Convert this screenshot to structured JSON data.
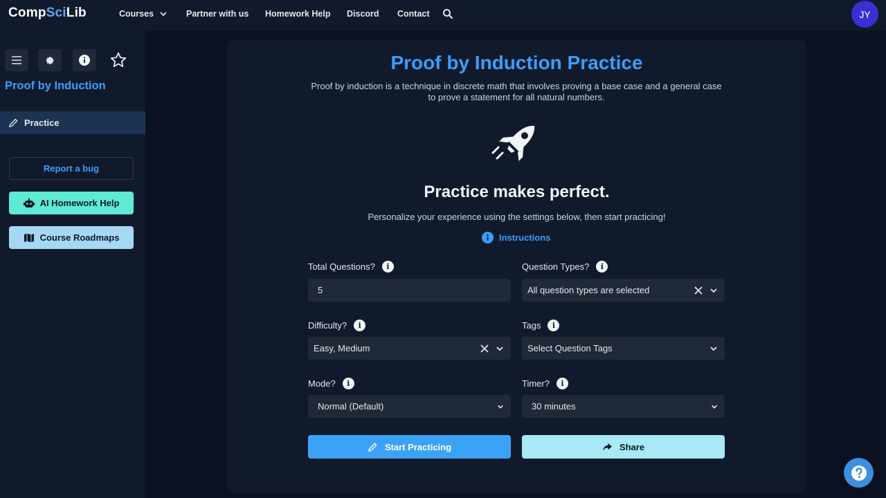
{
  "brand": {
    "name_part1": "Comp",
    "name_part2": "Sci",
    "name_part3": "Lib"
  },
  "nav": {
    "items": [
      {
        "label": "Courses",
        "has_dropdown": true
      },
      {
        "label": "Partner with us"
      },
      {
        "label": "Homework Help"
      },
      {
        "label": "Discord"
      },
      {
        "label": "Contact"
      }
    ],
    "search_icon": "search-icon",
    "avatar_initials": "JY"
  },
  "sidebar": {
    "icons": [
      "menu-icon",
      "gear-icon",
      "info-icon",
      "star-icon"
    ],
    "title": "Proof by Induction",
    "practice_label": "Practice",
    "report_label": "Report a bug",
    "ai_label": "AI Homework Help",
    "roadmaps_label": "Course Roadmaps"
  },
  "main": {
    "title": "Proof by Induction Practice",
    "description": "Proof by induction is a technique in discrete math that involves proving a base case and a general case to prove a statement for all natural numbers.",
    "heading": "Practice makes perfect.",
    "subheading": "Personalize your experience using the settings below, then start practicing!",
    "instructions_label": "Instructions",
    "fields": {
      "total_questions": {
        "label": "Total Questions?",
        "value": "5"
      },
      "question_types": {
        "label": "Question Types?",
        "value": "All question types are selected"
      },
      "difficulty": {
        "label": "Difficulty?",
        "value": "Easy, Medium"
      },
      "tags": {
        "label": "Tags",
        "value": "Select Question Tags"
      },
      "mode": {
        "label": "Mode?",
        "value": "Normal (Default)"
      },
      "timer": {
        "label": "Timer?",
        "value": "30 minutes"
      }
    },
    "start_label": "Start Practicing",
    "share_label": "Share"
  },
  "colors": {
    "accent": "#3b9eff",
    "page_bg": "#0b1120",
    "panel_bg": "#111a2b",
    "ai_button": "#5eead4",
    "roadmaps_button": "#a5d8f3",
    "share_button": "#a7e9f5",
    "avatar": "#3b2fd1"
  }
}
